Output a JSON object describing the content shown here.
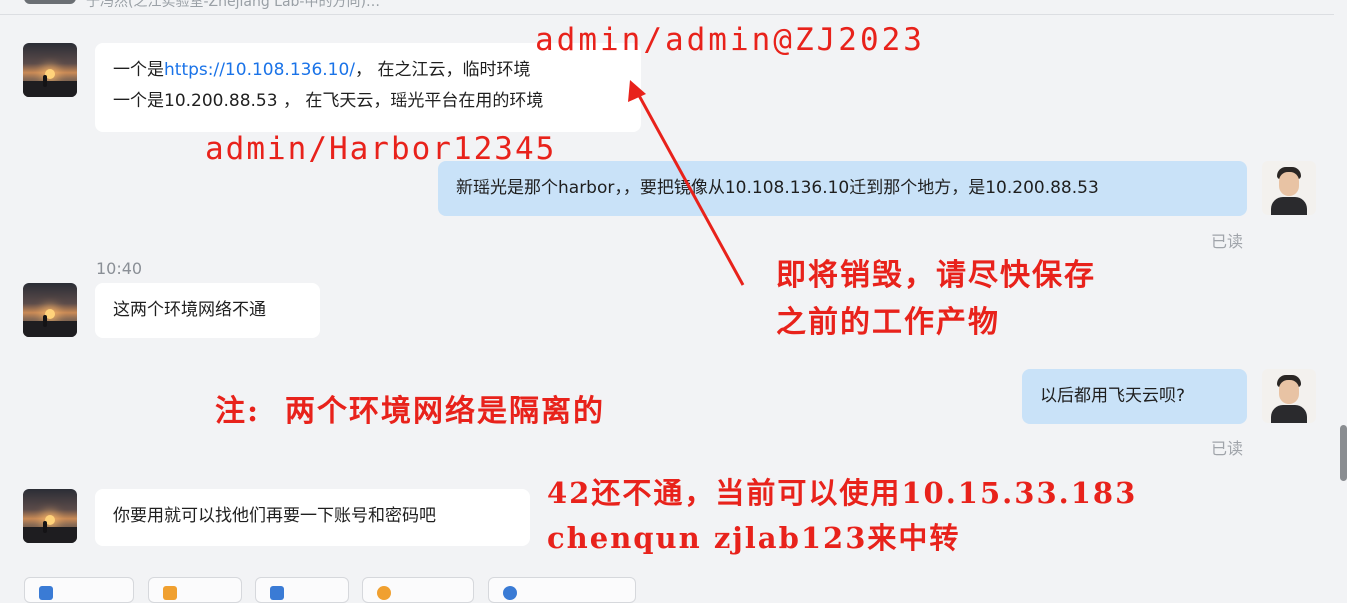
{
  "top_partial_text": "于冯然(之江实验室-Zhejiang Lab-中的方向)…",
  "messages": [
    {
      "side": "in",
      "lines": [
        {
          "prefix": "一个是",
          "link": "https://10.108.136.10/",
          "suffix": "， 在之江云，临时环境"
        },
        {
          "text": "一个是10.200.88.53 ， 在飞天云，瑶光平台在用的环境"
        }
      ]
    },
    {
      "side": "out",
      "text": "新瑶光是那个harbor，，要把镜像从10.108.136.10迁到那个地方，是10.200.88.53",
      "status": "已读"
    },
    {
      "time": "10:40"
    },
    {
      "side": "in",
      "text": "这两个环境网络不通"
    },
    {
      "side": "out",
      "text": "以后都用飞天云呗?",
      "status": "已读"
    },
    {
      "side": "in",
      "text": "你要用就可以找他们再要一下账号和密码吧"
    }
  ],
  "annotations": {
    "cred1": "admin/admin@ZJ2023",
    "cred2": "admin/Harbor12345",
    "warning_line1": "即将销毁，请尽快保存",
    "warning_line2": "之前的工作产物",
    "note": "注:  两个环境网络是隔离的",
    "relay_line1": "42还不通，当前可以使用10.15.33.183",
    "relay_line2": "chenqun zjlab123来中转"
  },
  "colors": {
    "annotation": "#e8221b",
    "outgoing_bubble": "#c9e2f8",
    "link": "#1a73e8"
  }
}
